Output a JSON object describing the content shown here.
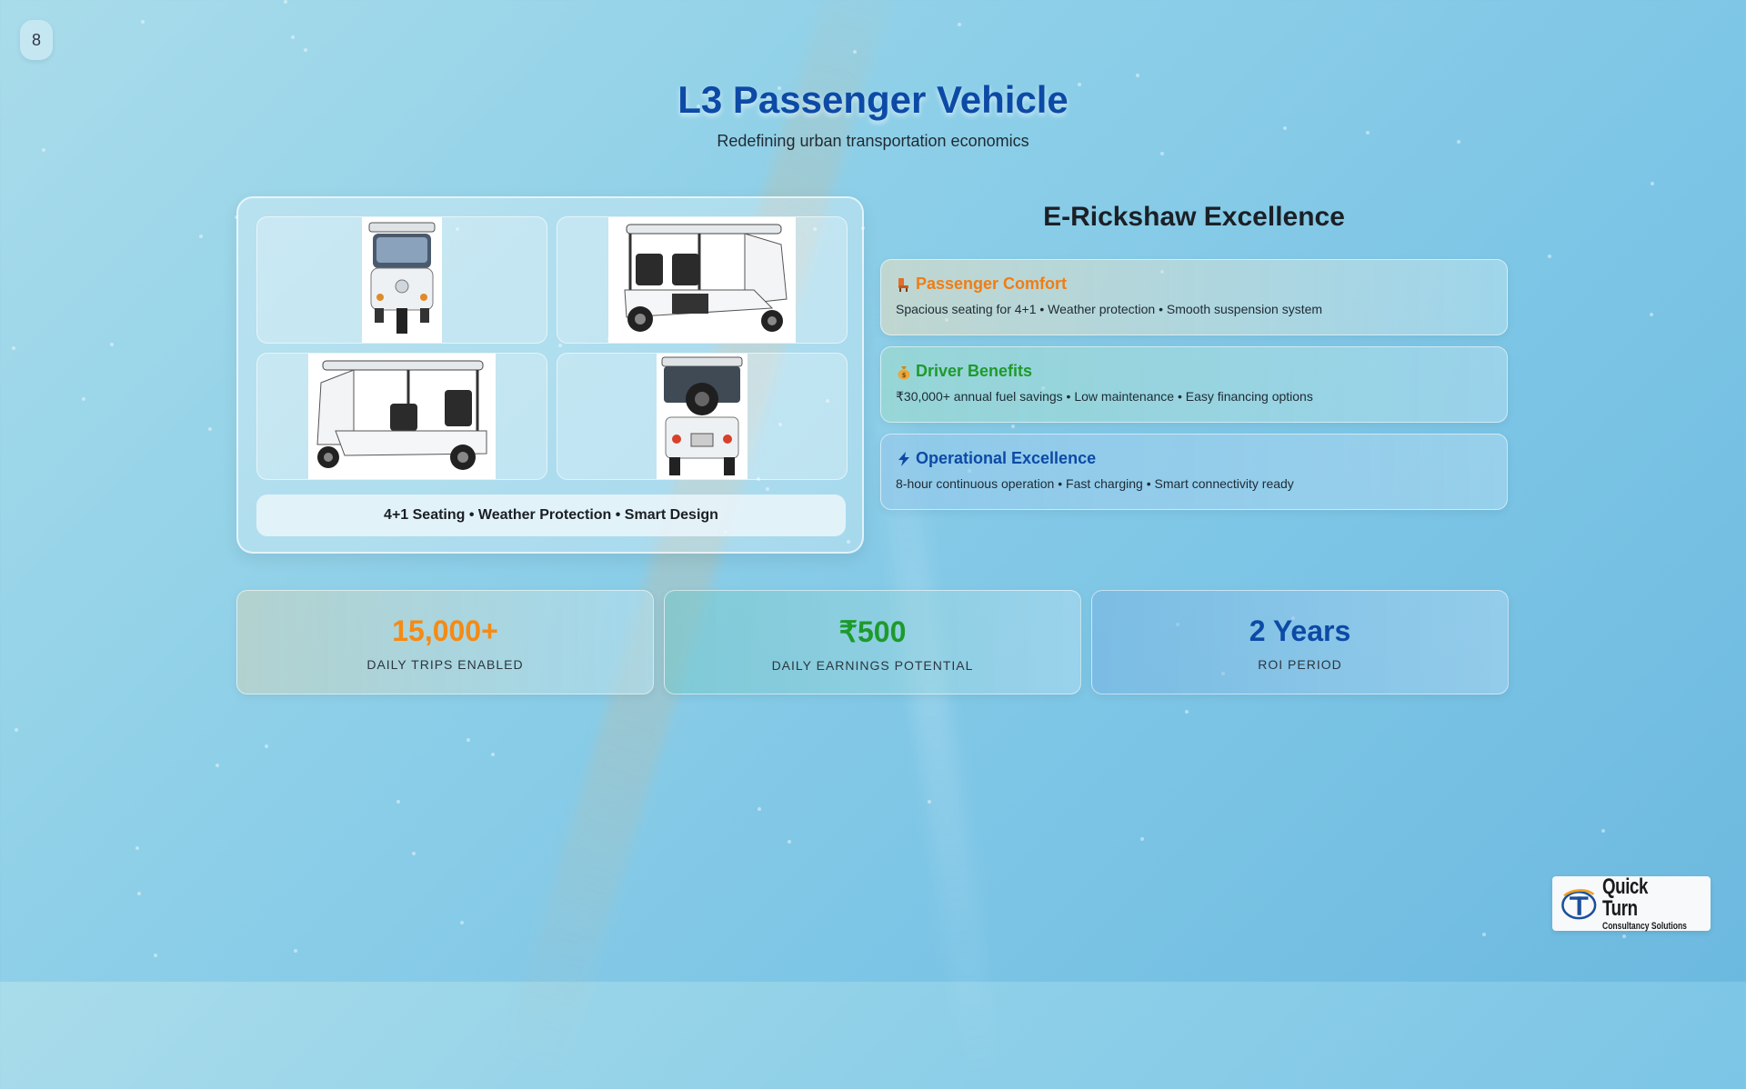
{
  "page_number": "8",
  "header": {
    "title": "L3 Passenger Vehicle",
    "subtitle": "Redefining urban transportation economics"
  },
  "gallery": {
    "caption": "4+1 Seating • Weather Protection • Smart Design"
  },
  "features": {
    "section_title": "E-Rickshaw Excellence",
    "items": [
      {
        "icon": "seat-icon",
        "title": "Passenger Comfort",
        "description": "Spacious seating for 4+1 • Weather protection • Smooth suspension system",
        "color": "#f07d14"
      },
      {
        "icon": "money-bag-icon",
        "title": "Driver Benefits",
        "description": "₹30,000+ annual fuel savings • Low maintenance • Easy financing options",
        "color": "#1e9a2c"
      },
      {
        "icon": "lightning-icon",
        "title": "Operational Excellence",
        "description": "8-hour continuous operation • Fast charging • Smart connectivity ready",
        "color": "#0c4aa6"
      }
    ]
  },
  "stats": [
    {
      "value": "15,000+",
      "label": "DAILY TRIPS ENABLED",
      "color": "#f58a14"
    },
    {
      "value": "₹500",
      "label": "DAILY EARNINGS POTENTIAL",
      "color": "#1e9a2c"
    },
    {
      "value": "2 Years",
      "label": "ROI PERIOD",
      "color": "#0c4aa6"
    }
  ],
  "logo": {
    "name": "Quick Turn",
    "tagline": "Consultancy Solutions"
  }
}
